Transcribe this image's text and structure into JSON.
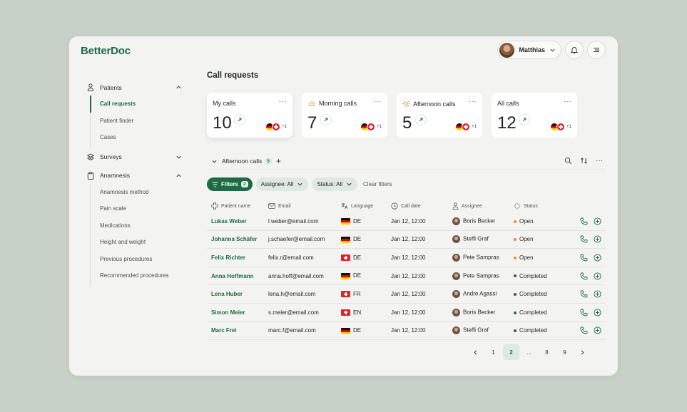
{
  "app": {
    "logo": "BetterDoc"
  },
  "header": {
    "user_name": "Matthias",
    "icons": [
      "bell-icon",
      "menu-icon",
      "chevron-down-icon"
    ]
  },
  "sidebar": {
    "groups": [
      {
        "label": "Patients",
        "icon": "person-icon",
        "expanded": true,
        "items": [
          "Call requests",
          "Patient finder",
          "Cases"
        ]
      },
      {
        "label": "Surveys",
        "icon": "layers-icon",
        "expanded": false,
        "items": []
      },
      {
        "label": "Anamnesis",
        "icon": "clipboard-icon",
        "expanded": true,
        "items": [
          "Anamnesis method",
          "Pain scale",
          "Medications",
          "Height and weight",
          "Previous procedures",
          "Recommended procedures"
        ]
      }
    ],
    "active_item": "Call requests"
  },
  "main": {
    "title": "Call requests",
    "cards": [
      {
        "title": "My calls",
        "icon": "",
        "count": "10",
        "extra": "+1"
      },
      {
        "title": "Morning calls",
        "icon": "sunrise-icon",
        "count": "7",
        "extra": "+1"
      },
      {
        "title": "Afternoon calls",
        "icon": "sun-icon",
        "count": "5",
        "extra": "+1"
      },
      {
        "title": "All calls",
        "icon": "",
        "count": "12",
        "extra": "+1"
      }
    ],
    "tab": {
      "label": "Afternoon calls",
      "count": "5"
    },
    "filters": {
      "filters_label": "Filters",
      "filters_count": "2",
      "assignee": "Assignee: All",
      "status": "Status: All",
      "clear": "Clear filters"
    },
    "columns": [
      "Patient name",
      "Email",
      "Language",
      "Call date",
      "Assignee",
      "Status"
    ],
    "rows": [
      {
        "name": "Lukas Weber",
        "email": "l.weber@email.com",
        "flag": "de",
        "lang": "DE",
        "date": "Jan 12, 12:00",
        "assignee": "Boris Becker",
        "status": "Open"
      },
      {
        "name": "Johanna Schäfer",
        "email": "j.schaefer@email.com",
        "flag": "de",
        "lang": "DE",
        "date": "Jan 12, 12:00",
        "assignee": "Steffi Graf",
        "status": "Open"
      },
      {
        "name": "Felix Richter",
        "email": "felix.r@email.com",
        "flag": "ch",
        "lang": "DE",
        "date": "Jan 12, 12:00",
        "assignee": "Pete Sampras",
        "status": "Open"
      },
      {
        "name": "Anna Hoffmann",
        "email": "anna.hoff@email.com",
        "flag": "de",
        "lang": "DE",
        "date": "Jan 12, 12:00",
        "assignee": "Pete Sampras",
        "status": "Completed"
      },
      {
        "name": "Lena Huber",
        "email": "lena.h@email.com",
        "flag": "ch",
        "lang": "FR",
        "date": "Jan 12, 12:00",
        "assignee": "Andre Agassi",
        "status": "Completed"
      },
      {
        "name": "Simon Meier",
        "email": "s.meier@email.com",
        "flag": "ch",
        "lang": "EN",
        "date": "Jan 12, 12:00",
        "assignee": "Boris Becker",
        "status": "Completed"
      },
      {
        "name": "Marc Frei",
        "email": "marc.f@email.com",
        "flag": "de",
        "lang": "DE",
        "date": "Jan 12, 12:00",
        "assignee": "Steffi Graf",
        "status": "Completed"
      }
    ],
    "status_colors": {
      "Open": "#e8912d",
      "Completed": "#1d6b45"
    },
    "pagination": {
      "pages": [
        "1",
        "2",
        "...",
        "8",
        "9"
      ],
      "current": "2"
    }
  },
  "colors": {
    "brand": "#1d6b45",
    "background": "#c8d1c8",
    "panel": "#f3f3f2"
  }
}
